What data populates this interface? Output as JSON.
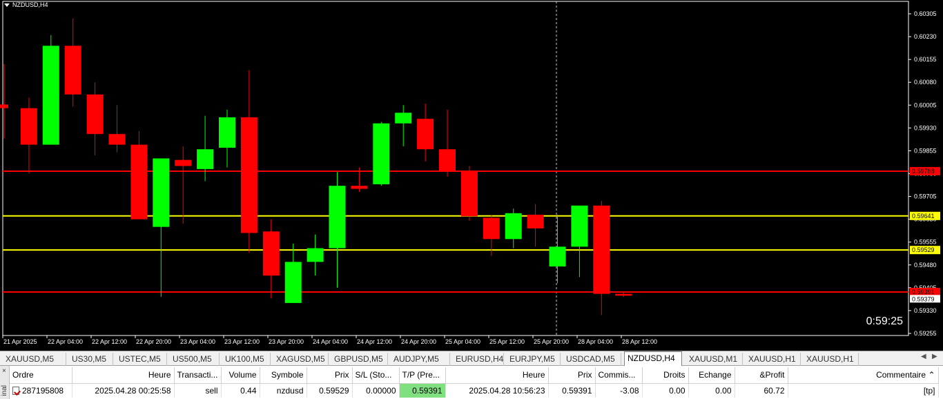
{
  "chart": {
    "title": "NZDUSD,H4",
    "timer": "0:59:25",
    "y_ticks": [
      "0.60305",
      "0.60230",
      "0.60155",
      "0.60080",
      "0.60005",
      "0.59930",
      "0.59855",
      "0.59780",
      "0.59705",
      "0.59630",
      "0.59555",
      "0.59480",
      "0.59405",
      "0.59330",
      "0.59255"
    ],
    "x_ticks": [
      "21 Apr 2025",
      "22 Apr 04:00",
      "22 Apr 12:00",
      "22 Apr 20:00",
      "23 Apr 04:00",
      "23 Apr 12:00",
      "23 Apr 20:00",
      "24 Apr 04:00",
      "24 Apr 12:00",
      "24 Apr 20:00",
      "25 Apr 04:00",
      "25 Apr 12:00",
      "25 Apr 20:00",
      "28 Apr 04:00",
      "28 Apr 12:00"
    ],
    "levels": [
      {
        "price": 0.59788,
        "label": "0.59788",
        "color": "#ff0000",
        "label_text_color": "#000"
      },
      {
        "price": 0.59641,
        "label": "0.59641",
        "color": "#ffff00",
        "label_text_color": "#000"
      },
      {
        "price": 0.59529,
        "label": "0.59529",
        "color": "#ffff00",
        "label_text_color": "#000"
      },
      {
        "price": 0.59391,
        "label": "0.59391",
        "color": "#ff0000",
        "label_text_color": "#000"
      }
    ],
    "current_price_label": "0.59379",
    "colors": {
      "bull": "#00ff00",
      "bear": "#ff0000",
      "background": "#000000",
      "axis": "#ffffff"
    }
  },
  "chart_data": {
    "type": "candlestick",
    "title": "NZDUSD,H4",
    "ylim": [
      0.59255,
      0.60305
    ],
    "candles": [
      {
        "o": 0.60007,
        "h": 0.6014,
        "l": 0.59895,
        "c": 0.59995
      },
      {
        "o": 0.59995,
        "h": 0.6003,
        "l": 0.5978,
        "c": 0.59875
      },
      {
        "o": 0.59875,
        "h": 0.60235,
        "l": 0.59875,
        "c": 0.602
      },
      {
        "o": 0.602,
        "h": 0.6029,
        "l": 0.6,
        "c": 0.6004
      },
      {
        "o": 0.6004,
        "h": 0.6008,
        "l": 0.5984,
        "c": 0.5991
      },
      {
        "o": 0.5991,
        "h": 0.60005,
        "l": 0.5985,
        "c": 0.59875
      },
      {
        "o": 0.59875,
        "h": 0.5992,
        "l": 0.5965,
        "c": 0.5963
      },
      {
        "o": 0.59605,
        "h": 0.5983,
        "l": 0.59375,
        "c": 0.5983
      },
      {
        "o": 0.59825,
        "h": 0.5987,
        "l": 0.59615,
        "c": 0.59805
      },
      {
        "o": 0.59795,
        "h": 0.5997,
        "l": 0.59755,
        "c": 0.5986
      },
      {
        "o": 0.59865,
        "h": 0.5999,
        "l": 0.598,
        "c": 0.59965
      },
      {
        "o": 0.59965,
        "h": 0.6012,
        "l": 0.5952,
        "c": 0.59585
      },
      {
        "o": 0.5959,
        "h": 0.5963,
        "l": 0.5937,
        "c": 0.59445
      },
      {
        "o": 0.59355,
        "h": 0.5955,
        "l": 0.59355,
        "c": 0.5949
      },
      {
        "o": 0.5949,
        "h": 0.5958,
        "l": 0.59445,
        "c": 0.59535
      },
      {
        "o": 0.59535,
        "h": 0.59785,
        "l": 0.59405,
        "c": 0.5974
      },
      {
        "o": 0.5974,
        "h": 0.598,
        "l": 0.5972,
        "c": 0.5973
      },
      {
        "o": 0.59745,
        "h": 0.5995,
        "l": 0.5974,
        "c": 0.59945
      },
      {
        "o": 0.59945,
        "h": 0.60005,
        "l": 0.5987,
        "c": 0.5998
      },
      {
        "o": 0.5996,
        "h": 0.6001,
        "l": 0.5982,
        "c": 0.5986
      },
      {
        "o": 0.5986,
        "h": 0.5999,
        "l": 0.5977,
        "c": 0.5979
      },
      {
        "o": 0.5979,
        "h": 0.59805,
        "l": 0.59625,
        "c": 0.5964
      },
      {
        "o": 0.59635,
        "h": 0.59645,
        "l": 0.5951,
        "c": 0.59565
      },
      {
        "o": 0.59565,
        "h": 0.59665,
        "l": 0.59535,
        "c": 0.5965
      },
      {
        "o": 0.59645,
        "h": 0.5968,
        "l": 0.5954,
        "c": 0.596
      },
      {
        "o": 0.59475,
        "h": 0.59645,
        "l": 0.5942,
        "c": 0.5954
      },
      {
        "o": 0.5954,
        "h": 0.5967,
        "l": 0.5944,
        "c": 0.59675
      },
      {
        "o": 0.59675,
        "h": 0.5969,
        "l": 0.59315,
        "c": 0.59385
      },
      {
        "o": 0.59385,
        "h": 0.59392,
        "l": 0.59375,
        "c": 0.59379
      }
    ]
  },
  "tabs": [
    "XAUUSD,M5",
    "US30,M5",
    "USTEC,M5",
    "US500,M5",
    "UK100,M5",
    "XAGUSD,M5",
    "GBPUSD,M5",
    "AUDJPY,M5",
    "EURUSD,H4",
    "EURJPY,M5",
    "USDCAD,M5",
    "NZDUSD,H4",
    "XAUUSD,M1",
    "XAUUSD,H1",
    "XAUUSD,H1"
  ],
  "active_tab": 11,
  "terminal": {
    "side_label": "inal",
    "close_glyph": "×",
    "columns": [
      "Ordre",
      "Heure",
      "Transacti...",
      "Volume",
      "Symbole",
      "Prix",
      "S/L (Sto...",
      "T/P (Pre...",
      "Heure",
      "Prix",
      "Commis...",
      "Droits",
      "Echange",
      "&Profit",
      "Commentaire"
    ],
    "sort_glyph": "⌃",
    "row": {
      "order": "287195808",
      "time": "2025.04.28 00:25:58",
      "type": "sell",
      "volume": "0.44",
      "symbol": "nzdusd",
      "price": "0.59529",
      "sl": "0.00000",
      "tp": "0.59391",
      "time2": "2025.04.28 10:56:23",
      "price2": "0.59391",
      "commission": "-3.08",
      "swap_rights": "0.00",
      "exchange": "0.00",
      "profit": "60.72",
      "comment": "[tp]"
    }
  }
}
